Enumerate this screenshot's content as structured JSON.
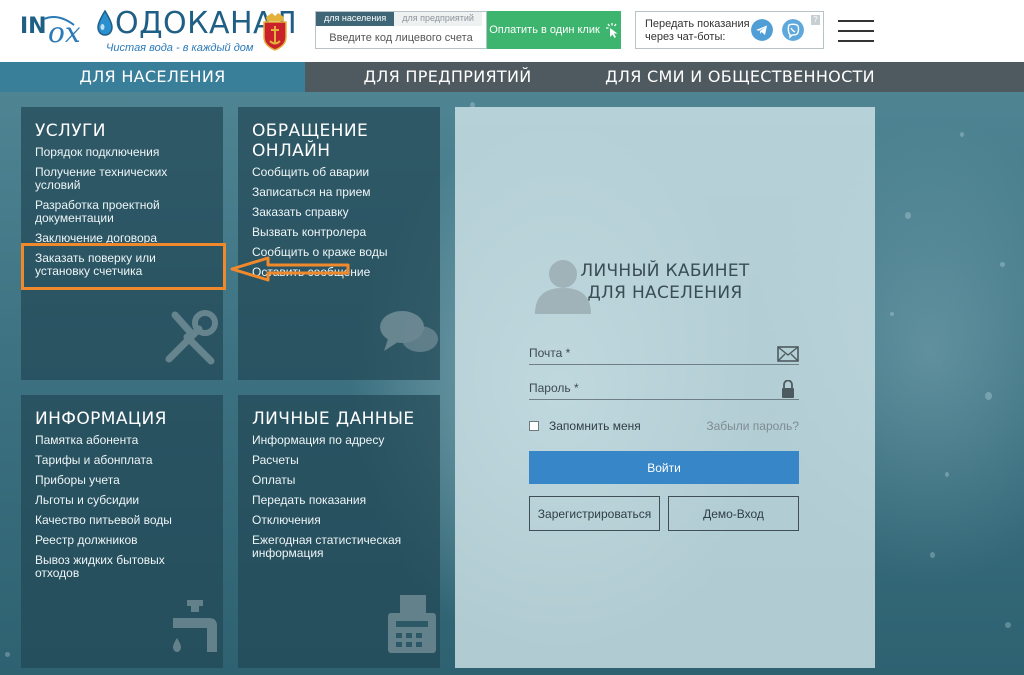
{
  "header": {
    "logo_word": "ОДОКАНАЛ",
    "logo_tagline": "Чистая вода - в каждый дом",
    "account": {
      "tab_population": "для населения",
      "tab_business": "для предприятий",
      "input_placeholder": "Введите код лицевого счета"
    },
    "pay_button": "Оплатить в один клик",
    "bots_text": "Передать показания через чат-боты:",
    "bots_help": "?"
  },
  "nav": {
    "items": [
      "ДЛЯ НАСЕЛЕНИЯ",
      "ДЛЯ ПРЕДПРИЯТИЙ",
      "ДЛЯ СМИ И ОБЩЕСТВЕННОСТИ"
    ]
  },
  "panels": {
    "services": {
      "title": "УСЛУГИ",
      "items": [
        "Порядок подключения",
        "Получение технических условий",
        "Разработка проектной документации",
        "Заключение договора",
        "Заказать поверку или установку счетчика"
      ]
    },
    "online": {
      "title": "ОБРАЩЕНИЕ ОНЛАЙН",
      "items": [
        "Сообщить об аварии",
        "Записаться на прием",
        "Заказать справку",
        "Вызвать контролера",
        "Сообщить о краже воды",
        "Оставить сообщение"
      ]
    },
    "info": {
      "title": "ИНФОРМАЦИЯ",
      "items": [
        "Памятка абонента",
        "Тарифы и абонплата",
        "Приборы учета",
        "Льготы и субсидии",
        "Качество питьевой воды",
        "Реестр должников",
        "Вывоз жидких бытовых отходов"
      ]
    },
    "personal": {
      "title": "ЛИЧНЫЕ ДАННЫЕ",
      "items": [
        "Информация по адресу",
        "Расчеты",
        "Оплаты",
        "Передать показания",
        "Отключения",
        "Ежегодная статистическая информация"
      ]
    }
  },
  "login": {
    "title_line1": "ЛИЧНЫЙ КАБИНЕТ",
    "title_line2": "ДЛЯ НАСЕЛЕНИЯ",
    "email_placeholder": "Почта *",
    "password_placeholder": "Пароль *",
    "remember": "Запомнить меня",
    "forgot": "Забыли пароль?",
    "login_button": "Войти",
    "register_button": "Зарегистрироваться",
    "demo_button": "Демо-Вход"
  },
  "colors": {
    "pay_green": "#3eb56e",
    "login_blue": "#3786c8",
    "highlight_orange": "#f0892c",
    "nav_active": "#3a7f9a"
  }
}
